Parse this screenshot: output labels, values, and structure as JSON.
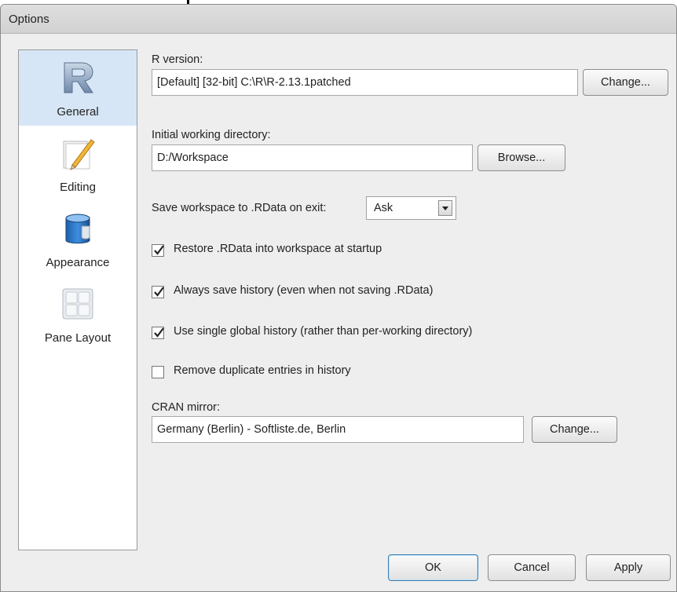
{
  "window": {
    "title": "Options"
  },
  "sidebar": {
    "items": [
      {
        "label": "General",
        "icon": "r-logo-icon",
        "selected": true
      },
      {
        "label": "Editing",
        "icon": "pencil-icon",
        "selected": false
      },
      {
        "label": "Appearance",
        "icon": "paint-bucket-icon",
        "selected": false
      },
      {
        "label": "Pane Layout",
        "icon": "pane-grid-icon",
        "selected": false
      }
    ]
  },
  "general": {
    "r_version": {
      "label": "R version:",
      "value": "[Default] [32-bit] C:\\R\\R-2.13.1patched",
      "button": "Change..."
    },
    "working_dir": {
      "label": "Initial working directory:",
      "value": "D:/Workspace",
      "button": "Browse..."
    },
    "save_workspace": {
      "label": "Save workspace to .RData on exit:",
      "selected": "Ask"
    },
    "checkboxes": [
      {
        "label": "Restore .RData into workspace at startup",
        "checked": true
      },
      {
        "label": "Always save history (even when not saving .RData)",
        "checked": true
      },
      {
        "label": "Use single global history (rather than per-working directory)",
        "checked": true
      },
      {
        "label": "Remove duplicate entries in history",
        "checked": false
      }
    ],
    "cran_mirror": {
      "label": "CRAN mirror:",
      "value": "Germany (Berlin) - Softliste.de, Berlin",
      "button": "Change..."
    }
  },
  "footer": {
    "ok": "OK",
    "cancel": "Cancel",
    "apply": "Apply"
  },
  "colors": {
    "selection": "#d7e6f6",
    "window_bg": "#eeeeee"
  }
}
